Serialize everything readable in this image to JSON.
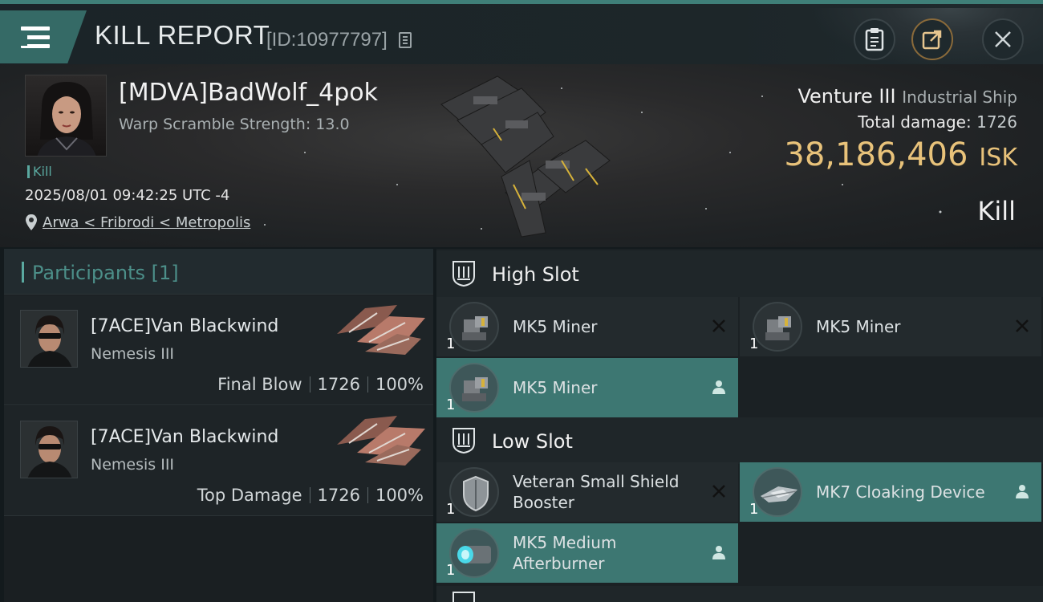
{
  "header": {
    "title": "KILL REPORT",
    "report_id": "[ID:10977797]"
  },
  "victim": {
    "pilot_name": "[MDVA]BadWolf_4pok",
    "warp_scramble": "Warp Scramble Strength: 13.0",
    "tag": "Kill",
    "datetime": "2025/08/01 09:42:25 UTC -4",
    "location": "Arwa < Fribrodi < Metropolis",
    "ship_name": "Venture III",
    "ship_class": "Industrial Ship",
    "total_damage_label": "Total damage:",
    "total_damage_value": "1726",
    "isk_value": "38,186,406",
    "isk_unit": "ISK",
    "result": "Kill"
  },
  "participants": {
    "label": "Participants",
    "count": "[1]",
    "rows": [
      {
        "name": "[7ACE]Van Blackwind",
        "ship": "Nemesis III",
        "role": "Final Blow",
        "damage": "1726",
        "percent": "100%"
      },
      {
        "name": "[7ACE]Van Blackwind",
        "ship": "Nemesis III",
        "role": "Top Damage",
        "damage": "1726",
        "percent": "100%"
      }
    ]
  },
  "slots": {
    "high": {
      "label": "High Slot",
      "items": [
        {
          "name": "MK5 Miner",
          "qty": "1",
          "state": "destroyed"
        },
        {
          "name": "MK5 Miner",
          "qty": "1",
          "state": "destroyed"
        },
        {
          "name": "MK5 Miner",
          "qty": "1",
          "state": "dropped"
        }
      ]
    },
    "low": {
      "label": "Low Slot",
      "items": [
        {
          "name": "Veteran Small Shield Booster",
          "qty": "1",
          "state": "destroyed"
        },
        {
          "name": "MK7 Cloaking Device",
          "qty": "1",
          "state": "dropped"
        },
        {
          "name": "MK5 Medium Afterburner",
          "qty": "1",
          "state": "dropped"
        }
      ]
    }
  },
  "colors": {
    "accent_teal": "#3d7772",
    "isk_gold": "#e8c27a",
    "header_tab": "#356a66"
  }
}
